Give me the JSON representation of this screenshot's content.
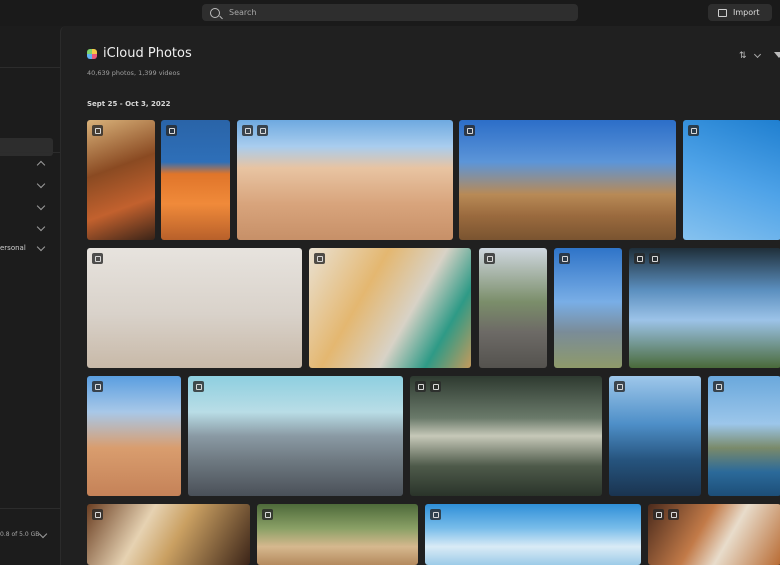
{
  "search": {
    "placeholder": "Search"
  },
  "toolbar": {
    "import_label": "Import"
  },
  "sidebar": {
    "items": [
      {
        "label": "ersonal"
      }
    ],
    "storage": "0.8 of 5.0 GB"
  },
  "main": {
    "title": "iCloud Photos",
    "subtitle": "40,639 photos, 1,399 videos",
    "section_date": "Sept 25 - Oct 3, 2022"
  },
  "icons": [
    "search-icon",
    "import-icon",
    "sort-icon",
    "filter-icon",
    "icloud-photos-icon",
    "chevron-down-icon",
    "cloud-badge-icon"
  ]
}
